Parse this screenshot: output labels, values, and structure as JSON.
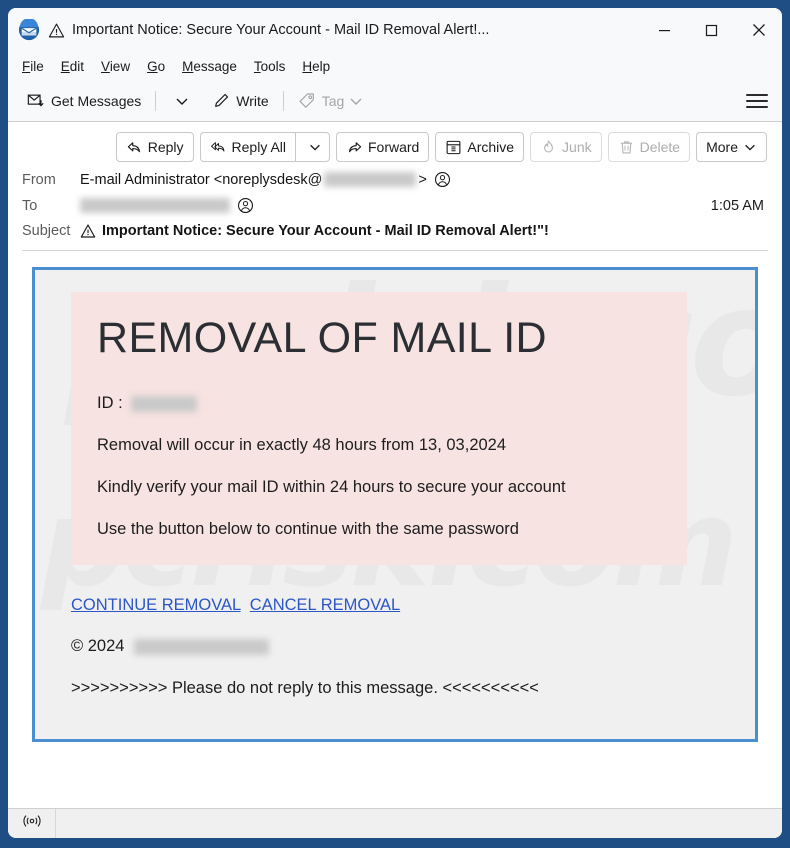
{
  "window": {
    "title": "Important Notice: Secure Your Account - Mail ID Removal Alert!...",
    "app_icon": "thunderbird-icon",
    "warning_icon": "warning-triangle-icon",
    "controls": {
      "minimize": "minimize-icon",
      "maximize": "maximize-icon",
      "close": "close-icon"
    },
    "frame_color": "#1f4e85"
  },
  "menubar": [
    {
      "label": "File",
      "accesskey": "F"
    },
    {
      "label": "Edit",
      "accesskey": "E"
    },
    {
      "label": "View",
      "accesskey": "V"
    },
    {
      "label": "Go",
      "accesskey": "G"
    },
    {
      "label": "Message",
      "accesskey": "M"
    },
    {
      "label": "Tools",
      "accesskey": "T"
    },
    {
      "label": "Help",
      "accesskey": "H"
    }
  ],
  "toolbar": {
    "get_messages": "Get Messages",
    "get_messages_icon": "inbox-download-icon",
    "get_messages_chevron": "chevron-down-icon",
    "write": "Write",
    "write_icon": "pencil-icon",
    "tag": "Tag",
    "tag_icon": "tag-icon",
    "tag_chevron": "chevron-down-icon",
    "tag_disabled": true,
    "app_menu_icon": "hamburger-menu-icon"
  },
  "message_actions": [
    {
      "label": "Reply",
      "icon": "reply-icon",
      "disabled": false,
      "chevron": false
    },
    {
      "label": "Reply All",
      "icon": "reply-all-icon",
      "disabled": false,
      "chevron": false
    },
    {
      "label": "Forward",
      "icon": "forward-icon",
      "disabled": false,
      "chevron": false
    },
    {
      "label": "Archive",
      "icon": "archive-box-icon",
      "disabled": false,
      "chevron": false
    },
    {
      "label": "Junk",
      "icon": "flame-icon",
      "disabled": true,
      "chevron": false
    },
    {
      "label": "Delete",
      "icon": "trash-icon",
      "disabled": true,
      "chevron": false
    },
    {
      "label": "More",
      "icon": "",
      "disabled": false,
      "chevron": true
    }
  ],
  "headers": {
    "from_label": "From",
    "from_name": "E-mail Administrator",
    "from_address_prefix": "<noreplysdesk@",
    "from_address_suffix": ">",
    "from_domain_redacted": true,
    "to_label": "To",
    "to_redacted": true,
    "contact_icon": "contact-circle-icon",
    "timestamp": "1:05 AM",
    "subject_label": "Subject",
    "subject_warning_icon": "warning-triangle-icon",
    "subject": "Important Notice: Secure Your Account - Mail ID Removal Alert!\"!"
  },
  "body": {
    "border_color": "#4a90d0",
    "highlight_color": "#f7e3e1",
    "background_color": "#f0f0f0",
    "link_color": "#2b56c4",
    "watermark_text": "pcrisk.com",
    "heading": "REMOVAL OF MAIL ID",
    "id_label": "ID :",
    "id_redacted": true,
    "line1": "Removal will occur in exactly 48 hours from 13, 03,2024",
    "line2": "Kindly verify your mail ID within 24 hours to secure your account",
    "line3": "Use the button below to continue with the same password",
    "link_continue": "CONTINUE REMOVAL",
    "link_cancel": "CANCEL REMOVAL",
    "copyright": "© 2024",
    "copyright_redacted": true,
    "noreply": ">>>>>>>>>> Please do not reply to this message. <<<<<<<<<<"
  },
  "statusbar": {
    "connection_icon": "broadcast-icon"
  }
}
